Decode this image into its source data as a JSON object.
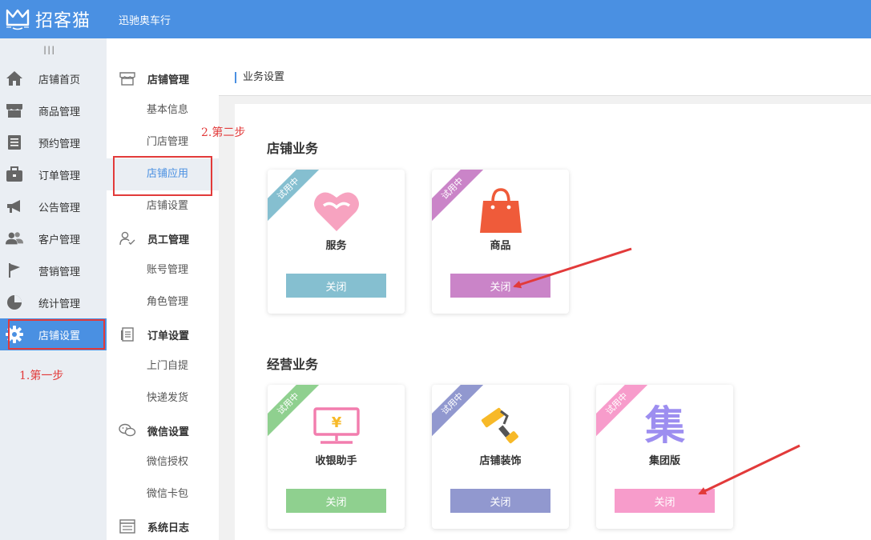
{
  "header": {
    "brand": "招客猫",
    "store_name": "迅驰奥车行",
    "collapse_glyph": "III"
  },
  "sidebar": {
    "items": [
      {
        "label": "店铺首页",
        "icon": "home-icon"
      },
      {
        "label": "商品管理",
        "icon": "store-icon"
      },
      {
        "label": "预约管理",
        "icon": "list-icon"
      },
      {
        "label": "订单管理",
        "icon": "briefcase-icon"
      },
      {
        "label": "公告管理",
        "icon": "megaphone-icon"
      },
      {
        "label": "客户管理",
        "icon": "users-icon"
      },
      {
        "label": "营销管理",
        "icon": "flag-icon"
      },
      {
        "label": "统计管理",
        "icon": "pie-chart-icon"
      },
      {
        "label": "店铺设置",
        "icon": "gear-icon",
        "active": true
      }
    ]
  },
  "subnav": {
    "groups": [
      {
        "title": "店铺管理",
        "icon": "shop-icon",
        "items": [
          "基本信息",
          "门店管理",
          "店铺应用",
          "店铺设置"
        ]
      },
      {
        "title": "员工管理",
        "icon": "user-check-icon",
        "items": [
          "账号管理",
          "角色管理"
        ]
      },
      {
        "title": "订单设置",
        "icon": "document-icon",
        "items": [
          "上门自提",
          "快递发货"
        ]
      },
      {
        "title": "微信设置",
        "icon": "wechat-icon",
        "items": [
          "微信授权",
          "微信卡包"
        ]
      },
      {
        "title": "系统日志",
        "icon": "log-icon",
        "items": []
      }
    ],
    "active_item": "店铺应用"
  },
  "main": {
    "page_title": "业务设置",
    "sections": [
      {
        "title": "店铺业务",
        "cards": [
          {
            "name": "服务",
            "badge": "试用中",
            "button": "关闭",
            "color": "#85bfd0",
            "ribbon_color": "#85bfd0",
            "icon": "heart-icon",
            "icon_color": "#f7a3c0"
          },
          {
            "name": "商品",
            "badge": "试用中",
            "button": "关闭",
            "color": "#ca84c8",
            "ribbon_color": "#ca84c8",
            "icon": "shopping-bag-icon",
            "icon_color": "#ef5b3a"
          }
        ]
      },
      {
        "title": "经营业务",
        "cards": [
          {
            "name": "收银助手",
            "badge": "试用中",
            "button": "关闭",
            "color": "#8fd08f",
            "ribbon_color": "#8fd08f",
            "icon": "cash-register-icon",
            "icon_color": "#f27dae"
          },
          {
            "name": "店铺装饰",
            "badge": "试用中",
            "button": "关闭",
            "color": "#9198cf",
            "ribbon_color": "#9198cf",
            "icon": "paint-roller-icon",
            "icon_color": "#f7b928"
          },
          {
            "name": "集团版",
            "badge": "试用中",
            "button": "关闭",
            "color": "#f79ccb",
            "ribbon_color": "#f79ccb",
            "icon": "group-icon",
            "icon_glyph": "集",
            "icon_color": "#9d8ef0"
          }
        ]
      }
    ]
  },
  "annotations": {
    "step1": "1.第一步",
    "step2": "2.第二步"
  },
  "colors": {
    "brand_blue": "#4a90e2",
    "sidebar_bg": "#eaeef3",
    "annotation_red": "#e23a3a"
  }
}
